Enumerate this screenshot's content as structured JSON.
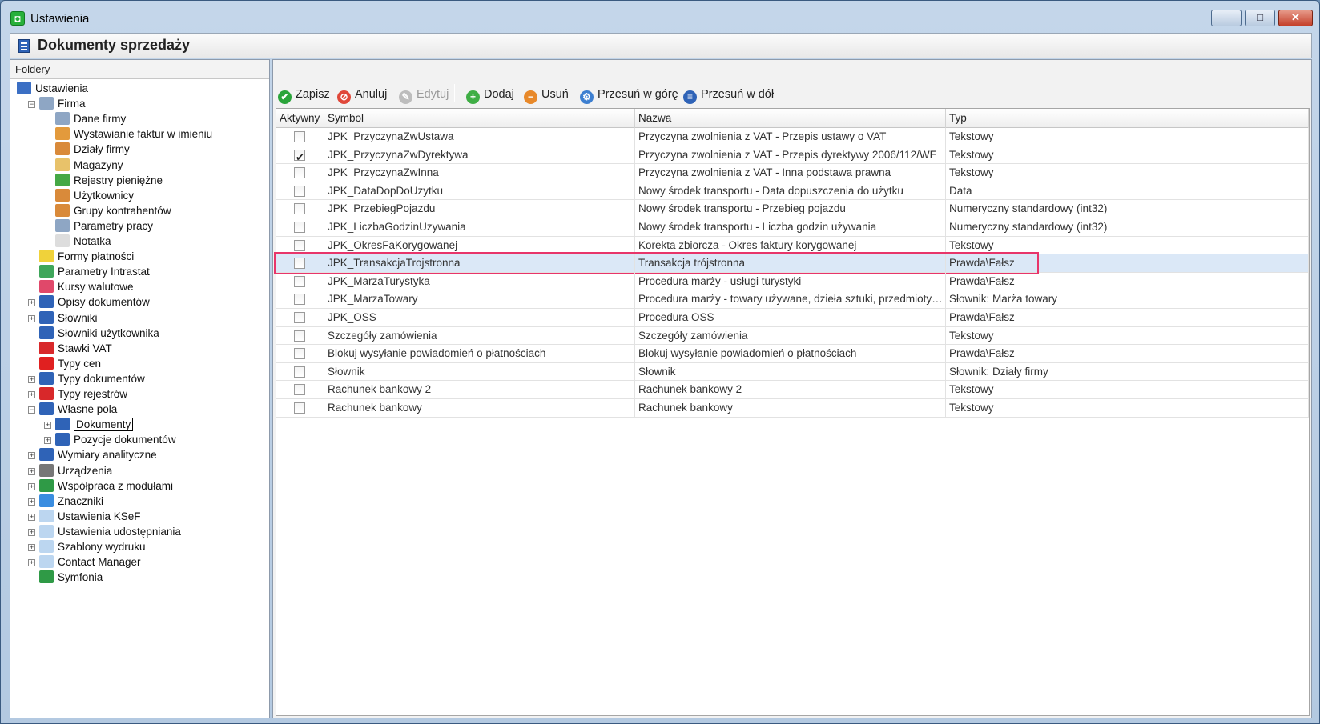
{
  "window": {
    "title": "Ustawienia",
    "header_title": "Dokumenty sprzedaży",
    "controls": {
      "minimize": "–",
      "maximize": "□",
      "close": "✕"
    }
  },
  "left_panel": {
    "header": "Foldery",
    "tree": [
      {
        "label": "Ustawienia",
        "icon": "tools-icon",
        "color": "#3b6fc4"
      },
      {
        "label": "Firma",
        "icon": "building-icon",
        "color": "#8ea6c4",
        "expander": "−"
      },
      {
        "label": "Dane firmy",
        "icon": "building-icon",
        "color": "#8ea6c4"
      },
      {
        "label": "Wystawianie faktur w imieniu",
        "icon": "user-icon",
        "color": "#e39a3c"
      },
      {
        "label": "Działy firmy",
        "icon": "users-icon",
        "color": "#d98a3a"
      },
      {
        "label": "Magazyny",
        "icon": "warehouse-icon",
        "color": "#e8c26a"
      },
      {
        "label": "Rejestry pieniężne",
        "icon": "money-icon",
        "color": "#45a845"
      },
      {
        "label": "Użytkownicy",
        "icon": "users-icon",
        "color": "#d98a3a"
      },
      {
        "label": "Grupy kontrahentów",
        "icon": "users-icon",
        "color": "#d98a3a"
      },
      {
        "label": "Parametry pracy",
        "icon": "building-icon",
        "color": "#8ea6c4"
      },
      {
        "label": "Notatka",
        "icon": "note-icon",
        "color": "#dddddd"
      },
      {
        "label": "Formy płatności",
        "icon": "payment-icon",
        "color": "#f0d23a"
      },
      {
        "label": "Parametry Intrastat",
        "icon": "intrastat-icon",
        "color": "#3ea65a"
      },
      {
        "label": "Kursy walutowe",
        "icon": "chart-line-icon",
        "color": "#e0486a"
      },
      {
        "label": "Opisy dokumentów",
        "icon": "document-icon",
        "color": "#2f63b7",
        "expander": "+"
      },
      {
        "label": "Słowniki",
        "icon": "document-icon",
        "color": "#2f63b7",
        "expander": "+"
      },
      {
        "label": "Słowniki użytkownika",
        "icon": "document-icon",
        "color": "#2f63b7"
      },
      {
        "label": "Stawki VAT",
        "icon": "vat-icon",
        "color": "#d8282a"
      },
      {
        "label": "Typy cen",
        "icon": "price-dot-icon",
        "color": "#e02020"
      },
      {
        "label": "Typy dokumentów",
        "icon": "documents-icon",
        "color": "#2f63b7",
        "expander": "+"
      },
      {
        "label": "Typy rejestrów",
        "icon": "register-icon",
        "color": "#d8282a",
        "expander": "+"
      },
      {
        "label": "Własne pola",
        "icon": "document-icon",
        "color": "#2f63b7",
        "expander": "−"
      },
      {
        "label": "Dokumenty",
        "icon": "document-icon",
        "color": "#2f63b7",
        "expander": "+",
        "selected": true
      },
      {
        "label": "Pozycje dokumentów",
        "icon": "document-icon",
        "color": "#2f63b7",
        "expander": "+"
      },
      {
        "label": "Wymiary analityczne",
        "icon": "document-icon",
        "color": "#2f63b7",
        "expander": "+"
      },
      {
        "label": "Urządzenia",
        "icon": "printer-icon",
        "color": "#777777",
        "expander": "+"
      },
      {
        "label": "Współpraca z modułami",
        "icon": "sync-icon",
        "color": "#2f9a46",
        "expander": "+"
      },
      {
        "label": "Znaczniki",
        "icon": "tag-icon",
        "color": "#3a8de0",
        "expander": "+"
      },
      {
        "label": "Ustawienia KSeF",
        "icon": "folder-icon",
        "color": "#bcd6f0",
        "expander": "+"
      },
      {
        "label": "Ustawienia udostępniania",
        "icon": "folder-icon",
        "color": "#bcd6f0",
        "expander": "+"
      },
      {
        "label": "Szablony wydruku",
        "icon": "folder-icon",
        "color": "#bcd6f0",
        "expander": "+"
      },
      {
        "label": "Contact Manager",
        "icon": "folder-icon",
        "color": "#bcd6f0",
        "expander": "+"
      },
      {
        "label": "Symfonia",
        "icon": "symfonia-icon",
        "color": "#2f9a46"
      }
    ]
  },
  "toolbar": {
    "buttons": [
      {
        "label": "Zapisz",
        "icon": "checkmark-icon",
        "glyph": "✔",
        "color": "#2aa43a"
      },
      {
        "label": "Anuluj",
        "icon": "cancel-icon",
        "glyph": "⊘",
        "color": "#e0483a"
      },
      {
        "label": "Edytuj",
        "icon": "pencil-icon",
        "glyph": "✎",
        "color": "#bdbdbd",
        "disabled": true
      },
      {
        "label": "Dodaj",
        "icon": "plus-icon",
        "glyph": "+",
        "color": "#3fae45"
      },
      {
        "label": "Usuń",
        "icon": "minus-icon",
        "glyph": "−",
        "color": "#e8892a"
      },
      {
        "label": "Przesuń w górę",
        "icon": "move-up-icon",
        "glyph": "⚙",
        "color": "#3d7fd0"
      },
      {
        "label": "Przesuń w dół",
        "icon": "move-down-icon",
        "glyph": "≡",
        "color": "#2f63b7"
      }
    ]
  },
  "grid": {
    "columns": [
      "Aktywny",
      "Symbol",
      "Nazwa",
      "Typ"
    ],
    "rows": [
      {
        "active": false,
        "symbol": "JPK_PrzyczynaZwUstawa",
        "name": "Przyczyna zwolnienia z VAT - Przepis ustawy o VAT",
        "type": "Tekstowy"
      },
      {
        "active": true,
        "symbol": "JPK_PrzyczynaZwDyrektywa",
        "name": "Przyczyna zwolnienia z VAT - Przepis dyrektywy 2006/112/WE",
        "type": "Tekstowy"
      },
      {
        "active": false,
        "symbol": "JPK_PrzyczynaZwInna",
        "name": "Przyczyna zwolnienia z VAT - Inna podstawa prawna",
        "type": "Tekstowy"
      },
      {
        "active": false,
        "symbol": "JPK_DataDopDoUzytku",
        "name": "Nowy środek transportu - Data dopuszczenia do użytku",
        "type": "Data"
      },
      {
        "active": false,
        "symbol": "JPK_PrzebiegPojazdu",
        "name": "Nowy środek transportu - Przebieg pojazdu",
        "type": "Numeryczny standardowy (int32)"
      },
      {
        "active": false,
        "symbol": "JPK_LiczbaGodzinUzywania",
        "name": "Nowy środek transportu - Liczba godzin używania",
        "type": "Numeryczny standardowy (int32)"
      },
      {
        "active": false,
        "symbol": "JPK_OkresFaKorygowanej",
        "name": "Korekta zbiorcza - Okres faktury korygowanej",
        "type": "Tekstowy"
      },
      {
        "active": false,
        "symbol": "JPK_TransakcjaTrojstronna",
        "name": "Transakcja trójstronna",
        "type": "Prawda\\Fałsz",
        "highlighted": true
      },
      {
        "active": false,
        "symbol": "JPK_MarzaTurystyka",
        "name": "Procedura marży - usługi turystyki",
        "type": "Prawda\\Fałsz"
      },
      {
        "active": false,
        "symbol": "JPK_MarzaTowary",
        "name": "Procedura marży - towary używane, dzieła sztuki, przedmioty ko...",
        "type": "Słownik: Marża towary"
      },
      {
        "active": false,
        "symbol": "JPK_OSS",
        "name": "Procedura OSS",
        "type": "Prawda\\Fałsz"
      },
      {
        "active": false,
        "symbol": "Szczegóły zamówienia",
        "name": "Szczegóły zamówienia",
        "type": "Tekstowy"
      },
      {
        "active": false,
        "symbol": "Blokuj wysyłanie powiadomień o płatnościach",
        "name": "Blokuj wysyłanie powiadomień o płatnościach",
        "type": "Prawda\\Fałsz"
      },
      {
        "active": false,
        "symbol": "Słownik",
        "name": "Słownik",
        "type": "Słownik: Działy firmy"
      },
      {
        "active": false,
        "symbol": "Rachunek bankowy 2",
        "name": "Rachunek bankowy 2",
        "type": "Tekstowy"
      },
      {
        "active": false,
        "symbol": "Rachunek bankowy",
        "name": "Rachunek bankowy",
        "type": "Tekstowy"
      }
    ]
  }
}
